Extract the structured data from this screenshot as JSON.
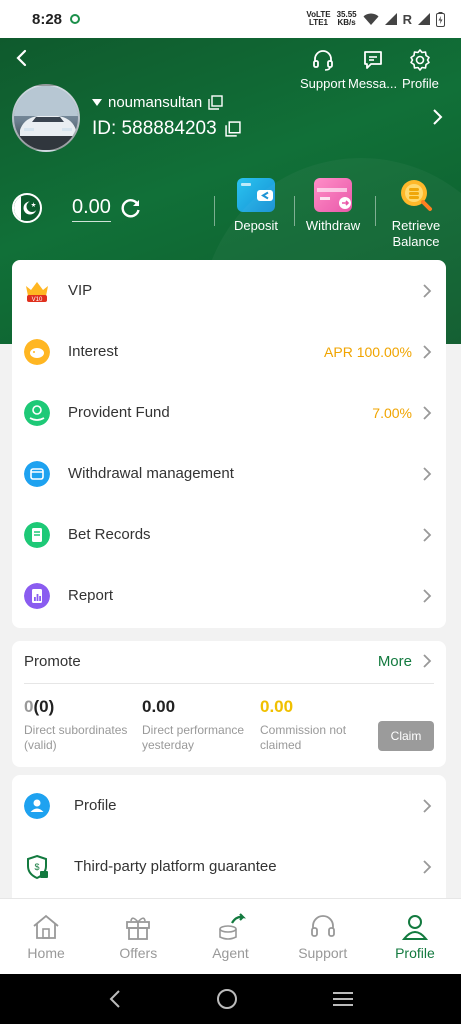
{
  "status_bar": {
    "time": "8:28",
    "network_speed_top": "35.55",
    "network_speed_bottom": "KB/s",
    "volte_top": "VoLTE",
    "volte_bottom": "LTE1",
    "carrier_r": "R"
  },
  "header": {
    "top_actions": [
      {
        "label": "Support",
        "icon": "headset-icon"
      },
      {
        "label": "Messa...",
        "icon": "message-icon"
      },
      {
        "label": "Profile",
        "icon": "gear-icon"
      }
    ],
    "username": "noumansultan",
    "user_id": "ID: 588884203",
    "balance": "0.00",
    "actions": [
      {
        "label": "Deposit",
        "icon": "deposit-wallet-icon"
      },
      {
        "label": "Withdraw",
        "icon": "withdraw-card-icon"
      },
      {
        "label": "Retrieve Balance",
        "icon": "coins-search-icon"
      }
    ]
  },
  "menu": [
    {
      "label": "VIP",
      "value": "",
      "icon": "vip-crown-icon"
    },
    {
      "label": "Interest",
      "value": "APR 100.00%",
      "icon": "piggy-bank-icon"
    },
    {
      "label": "Provident Fund",
      "value": "7.00%",
      "icon": "fund-hand-icon"
    },
    {
      "label": "Withdrawal management",
      "value": "",
      "icon": "wallet-icon"
    },
    {
      "label": "Bet Records",
      "value": "",
      "icon": "records-icon"
    },
    {
      "label": "Report",
      "value": "",
      "icon": "report-chart-icon"
    }
  ],
  "promote": {
    "title": "Promote",
    "more": "More",
    "stats": [
      {
        "value_main": "0",
        "value_extra": "(0)",
        "desc_line1": "Direct subordinates",
        "desc_line2": "(valid)"
      },
      {
        "value_main": "0.00",
        "value_extra": "",
        "desc_line1": "Direct performance",
        "desc_line2": "yesterday"
      },
      {
        "value_main": "0.00",
        "value_extra": "",
        "desc_line1": "Commission not",
        "desc_line2": "claimed"
      }
    ],
    "claim_label": "Claim"
  },
  "profile_menu": [
    {
      "label": "Profile",
      "icon": "user-icon"
    },
    {
      "label": "Third-party platform guarantee",
      "icon": "shield-lock-icon"
    }
  ],
  "bottom_nav": [
    {
      "label": "Home",
      "icon": "home-icon",
      "active": false
    },
    {
      "label": "Offers",
      "icon": "gift-icon",
      "active": false
    },
    {
      "label": "Agent",
      "icon": "agent-icon",
      "active": false
    },
    {
      "label": "Support",
      "icon": "headset-icon",
      "active": false
    },
    {
      "label": "Profile",
      "icon": "user-icon",
      "active": true
    }
  ],
  "colors": {
    "brand_green": "#117038",
    "accent_orange": "#f0a400",
    "claim_gray": "#9b9b9b"
  }
}
